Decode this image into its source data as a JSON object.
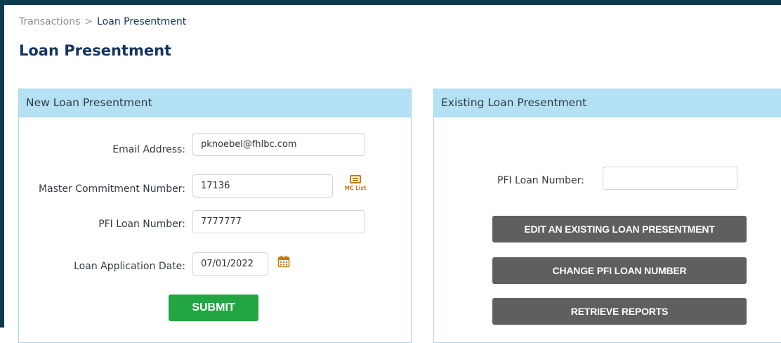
{
  "breadcrumb": {
    "parent": "Transactions",
    "separator": ">",
    "current": "Loan Presentment"
  },
  "page": {
    "title": "Loan Presentment"
  },
  "new_panel": {
    "title": "New Loan Presentment",
    "email_label": "Email Address:",
    "email_value": "pknoebel@fhlbc.com",
    "mc_label": "Master Commitment Number:",
    "mc_value": "17136",
    "mc_list_caption": "MC List",
    "pfi_label": "PFI Loan Number:",
    "pfi_value": "7777777",
    "date_label": "Loan Application Date:",
    "date_value": "07/01/2022",
    "submit_label": "SUBMIT"
  },
  "existing_panel": {
    "title": "Existing Loan Presentment",
    "pfi_label": "PFI Loan Number:",
    "pfi_value": "",
    "edit_label": "EDIT AN EXISTING LOAN PRESENTMENT",
    "change_label": "CHANGE PFI LOAN NUMBER",
    "reports_label": "RETRIEVE REPORTS"
  },
  "icons": {
    "mc_list": "document-list-icon",
    "calendar": "calendar-icon"
  },
  "colors": {
    "frame": "#0c3a4f",
    "title": "#15355e",
    "panel_header": "#b4e1f3",
    "submit": "#21a642",
    "action_button": "#5d5f61",
    "icon_accent": "#c47a12"
  }
}
